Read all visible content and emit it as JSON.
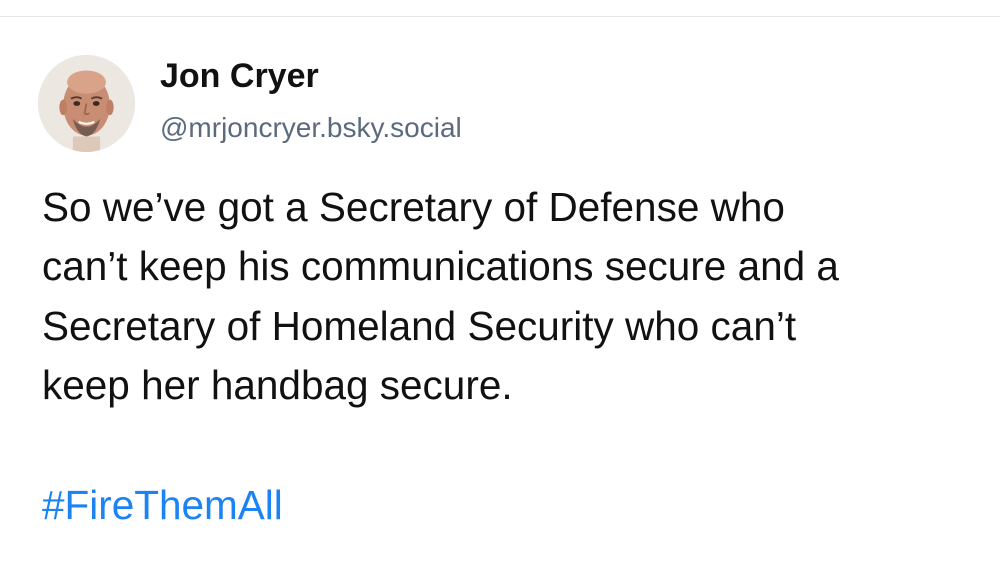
{
  "post": {
    "author": {
      "display_name": "Jon Cryer",
      "handle": "@mrjoncryer.bsky.social",
      "avatar_icon": "avatar-photo-icon"
    },
    "text": "So we’ve got a Secretary of Defense who\ncan’t keep his communications secure and a\nSecretary of Homeland Security who can’t\nkeep her handbag secure.",
    "hashtag": "#FireThemAll",
    "colors": {
      "text": "#111111",
      "handle": "#5b6b7d",
      "hashtag": "#1d83f2",
      "background": "#ffffff"
    }
  }
}
